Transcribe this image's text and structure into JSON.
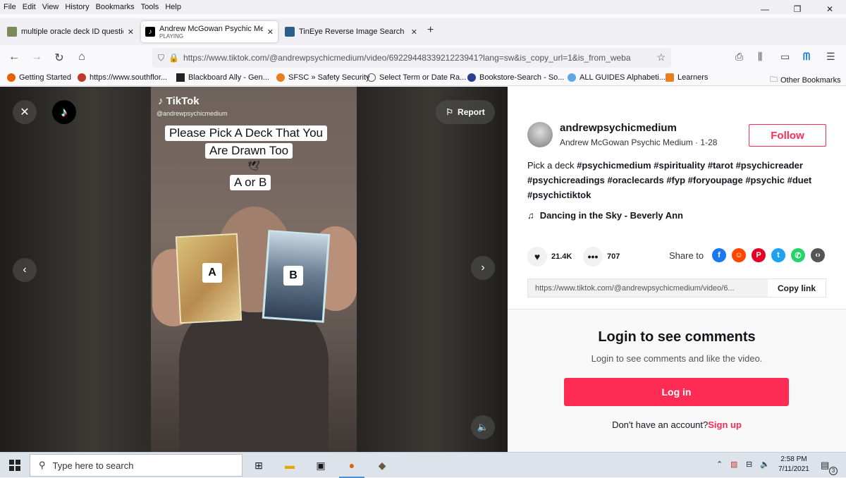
{
  "menubar": {
    "items": [
      "File",
      "Edit",
      "View",
      "History",
      "Bookmarks",
      "Tools",
      "Help"
    ]
  },
  "window_controls": {
    "minimize": "—",
    "restore": "❐",
    "close": "✕"
  },
  "tabs": [
    {
      "title": "multiple oracle deck ID questio",
      "status": "",
      "close": "✕"
    },
    {
      "title": "Andrew McGowan Psychic Med",
      "status": "PLAYING",
      "close": "✕"
    },
    {
      "title": "TinEye Reverse Image Search",
      "status": "",
      "close": "✕"
    }
  ],
  "new_tab": "+",
  "nav": {
    "back": "←",
    "forward": "→",
    "reload": "↻",
    "home": "⌂"
  },
  "url": "https://www.tiktok.com/@andrewpsychicmedium/video/6922944833921223941?lang=sw&is_copy_url=1&is_from_weba",
  "bookmarks": [
    {
      "label": "Getting Started",
      "color": "#e66000"
    },
    {
      "label": "https://www.southflor...",
      "color": "#c0392b"
    },
    {
      "label": "Blackboard Ally - Gen...",
      "color": "#222222"
    },
    {
      "label": "SFSC » Safety Security",
      "color": "#e67e22"
    },
    {
      "label": "Select Term or Date Ra...",
      "color": "#555555"
    },
    {
      "label": "Bookstore-Search - So...",
      "color": "#2c3e8f"
    },
    {
      "label": "ALL GUIDES Alphabeti...",
      "color": "#5fa8e8"
    },
    {
      "label": "Learners",
      "color": "#e67e22"
    }
  ],
  "other_bookmarks": "Other Bookmarks",
  "video": {
    "brand": "TikTok",
    "handle": "@andrewpsychicmedium",
    "caption_line1": "Please Pick A Deck That You",
    "caption_line2": "Are Drawn Too",
    "emoji": "🕊",
    "caption_choice": "A or B",
    "card_a": "A",
    "card_b": "B",
    "report": "Report"
  },
  "profile": {
    "username": "andrewpsychicmedium",
    "nickname": "Andrew McGowan Psychic Medium · 1-28",
    "follow": "Follow",
    "desc_plain": "Pick a deck",
    "hashtags": [
      "#psychicmedium",
      "#spirituality",
      "#tarot",
      "#psychicreader",
      "#psychicreadings",
      "#oraclecards",
      "#fyp",
      "#foryoupage",
      "#psychic",
      "#duet",
      "#psychictiktok"
    ],
    "music": "Dancing in the Sky - Beverly Ann",
    "likes": "21.4K",
    "comments": "707",
    "share_label": "Share to",
    "link": "https://www.tiktok.com/@andrewpsychicmedium/video/6...",
    "copy_link": "Copy link"
  },
  "login": {
    "title": "Login to see comments",
    "subtitle": "Login to see comments and like the video.",
    "button": "Log in",
    "no_account": "Don't have an account?",
    "signup": "Sign up"
  },
  "taskbar": {
    "search_placeholder": "Type here to search",
    "time": "2:58 PM",
    "date": "7/11/2021",
    "notifications": "3"
  },
  "colors": {
    "accent": "#fe2c55"
  }
}
